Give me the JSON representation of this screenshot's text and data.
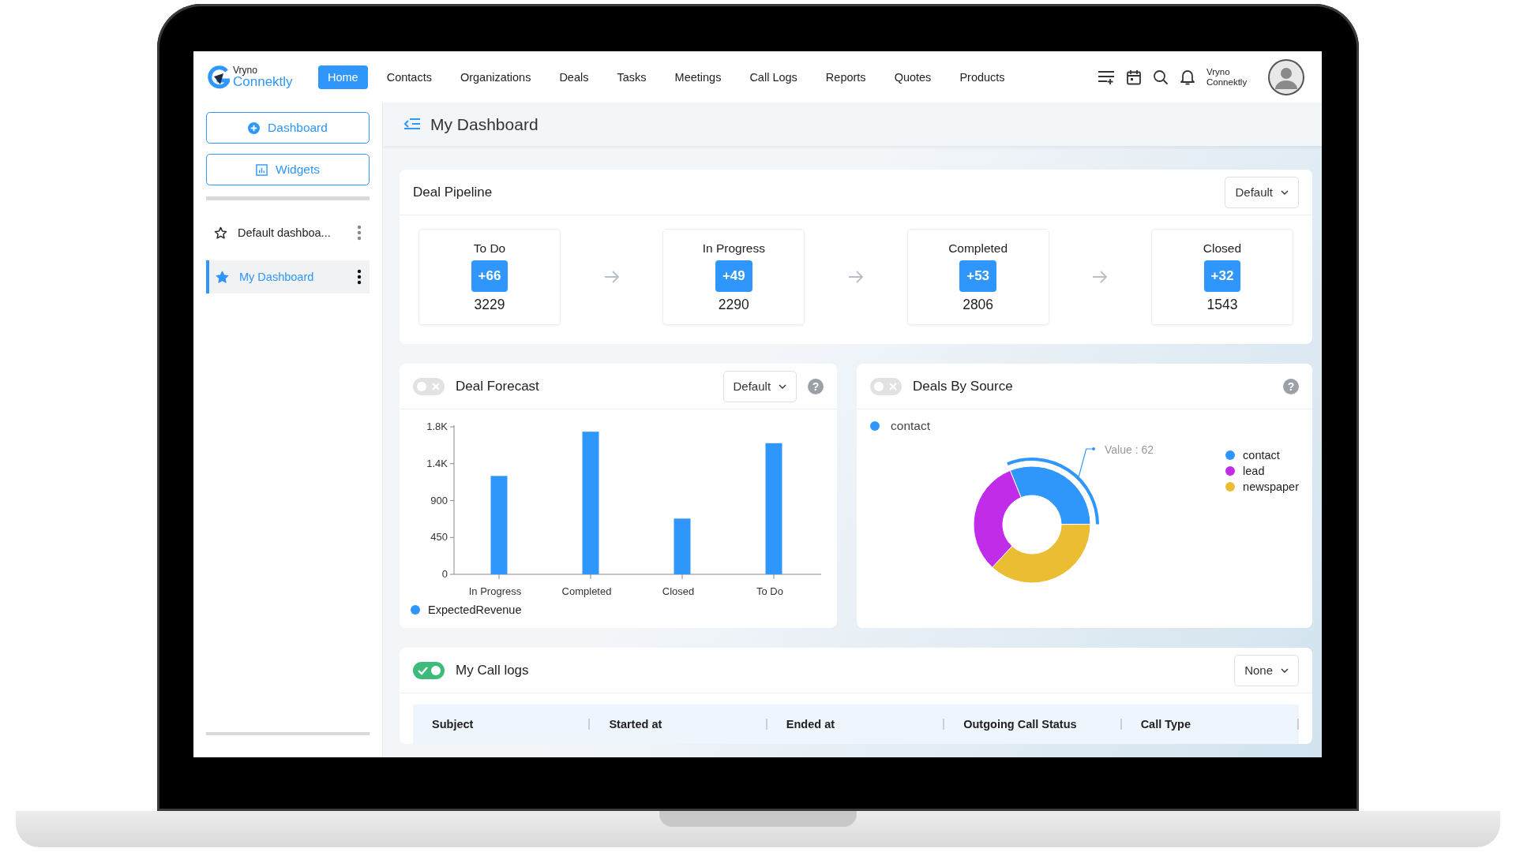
{
  "brand": {
    "top": "Vryno",
    "bottom": "Connektly"
  },
  "nav": [
    {
      "label": "Home",
      "selected": true
    },
    {
      "label": "Contacts",
      "selected": false
    },
    {
      "label": "Organizations",
      "selected": false
    },
    {
      "label": "Deals",
      "selected": false
    },
    {
      "label": "Tasks",
      "selected": false
    },
    {
      "label": "Meetings",
      "selected": false
    },
    {
      "label": "Call Logs",
      "selected": false
    },
    {
      "label": "Reports",
      "selected": false
    },
    {
      "label": "Quotes",
      "selected": false
    },
    {
      "label": "Products",
      "selected": false
    }
  ],
  "user": {
    "name": "Vryno Connektly"
  },
  "sidebar": {
    "buttons": [
      {
        "kind": "add",
        "label": "Dashboard"
      },
      {
        "kind": "widgets",
        "label": "Widgets"
      }
    ],
    "dashboards": [
      {
        "label": "Default dashboa...",
        "selected": false
      },
      {
        "label": "My Dashboard",
        "selected": true
      }
    ]
  },
  "page_title": "My Dashboard",
  "pipeline": {
    "title": "Deal Pipeline",
    "dropdown": "Default",
    "stages": [
      {
        "label": "To Do",
        "delta": "+66",
        "count": "3229"
      },
      {
        "label": "In Progress",
        "delta": "+49",
        "count": "2290"
      },
      {
        "label": "Completed",
        "delta": "+53",
        "count": "2806"
      },
      {
        "label": "Closed",
        "delta": "+32",
        "count": "1543"
      }
    ]
  },
  "forecast": {
    "toggle_on": false,
    "title": "Deal Forecast",
    "dropdown": "Default",
    "help": "?",
    "chart_data": {
      "type": "bar",
      "categories": [
        "In Progress",
        "Completed",
        "Closed",
        "To Do"
      ],
      "series": [
        {
          "name": "ExpectedRevenue",
          "color": "#2f96fb",
          "values": [
            1200,
            1740,
            680,
            1600
          ]
        }
      ],
      "ylim": [
        0,
        1800
      ],
      "yticks": [
        0,
        450,
        900,
        {
          "value": 1350,
          "label": "1.4K"
        },
        {
          "value": 1800,
          "label": "1.8K"
        }
      ]
    }
  },
  "source": {
    "toggle_on": false,
    "title": "Deals By Source",
    "help": "?",
    "filter": {
      "label": "contact",
      "color": "#2f96fb"
    },
    "tooltip": "Value : 62",
    "legend": [
      {
        "label": "contact",
        "color": "#2f96fb"
      },
      {
        "label": "lead",
        "color": "#c02ce8"
      },
      {
        "label": "newspaper",
        "color": "#ebbd32"
      }
    ]
  },
  "call_logs": {
    "toggle_on": true,
    "title": "My Call logs",
    "dropdown": "None",
    "columns": [
      "Subject",
      "Started at",
      "Ended at",
      "Outgoing Call Status",
      "Call Type"
    ]
  }
}
